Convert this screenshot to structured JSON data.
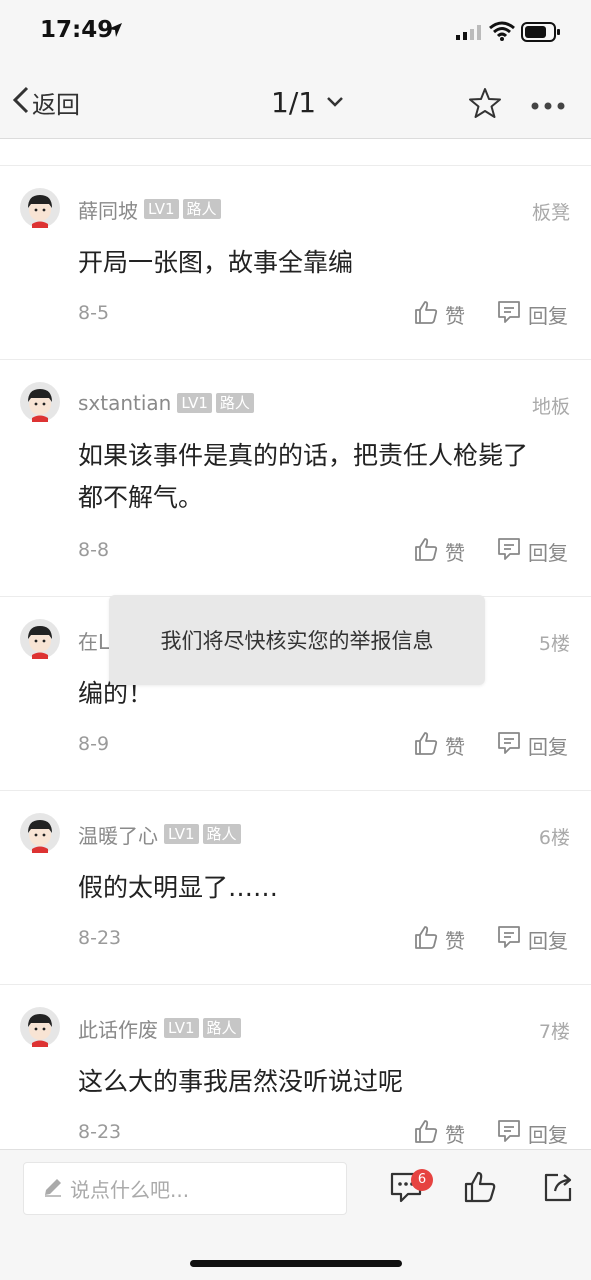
{
  "status": {
    "time": "17:49"
  },
  "nav": {
    "back_label": "返回",
    "page_label": "1/1"
  },
  "comments": [
    {
      "author": "薛同坡",
      "level": "LV1",
      "role": "路人",
      "floor": "板凳",
      "text": "开局一张图，故事全靠编",
      "date": "8-5",
      "like": "赞",
      "reply": "回复"
    },
    {
      "author": "sxtantian",
      "level": "LV1",
      "role": "路人",
      "floor": "地板",
      "text": "如果该事件是真的的话，把责任人枪毙了都不解气。",
      "date": "8-8",
      "like": "赞",
      "reply": "回复"
    },
    {
      "author": "在L",
      "level": "",
      "role": "",
      "floor": "5楼",
      "text": "编的！",
      "date": "8-9",
      "like": "赞",
      "reply": "回复"
    },
    {
      "author": "温暖了心",
      "level": "LV1",
      "role": "路人",
      "floor": "6楼",
      "text": "假的太明显了……",
      "date": "8-23",
      "like": "赞",
      "reply": "回复"
    },
    {
      "author": "此话作废",
      "level": "LV1",
      "role": "路人",
      "floor": "7楼",
      "text": "这么大的事我居然没听说过呢",
      "date": "8-23",
      "like": "赞",
      "reply": "回复"
    }
  ],
  "toast": {
    "text": "我们将尽快核实您的举报信息"
  },
  "bottom": {
    "input_placeholder": "说点什么吧...",
    "comment_count": "6"
  },
  "colors": {
    "badge_red": "#e64340",
    "badge_gray": "#c6c6c6",
    "bar_bg": "#f6f6f6"
  }
}
